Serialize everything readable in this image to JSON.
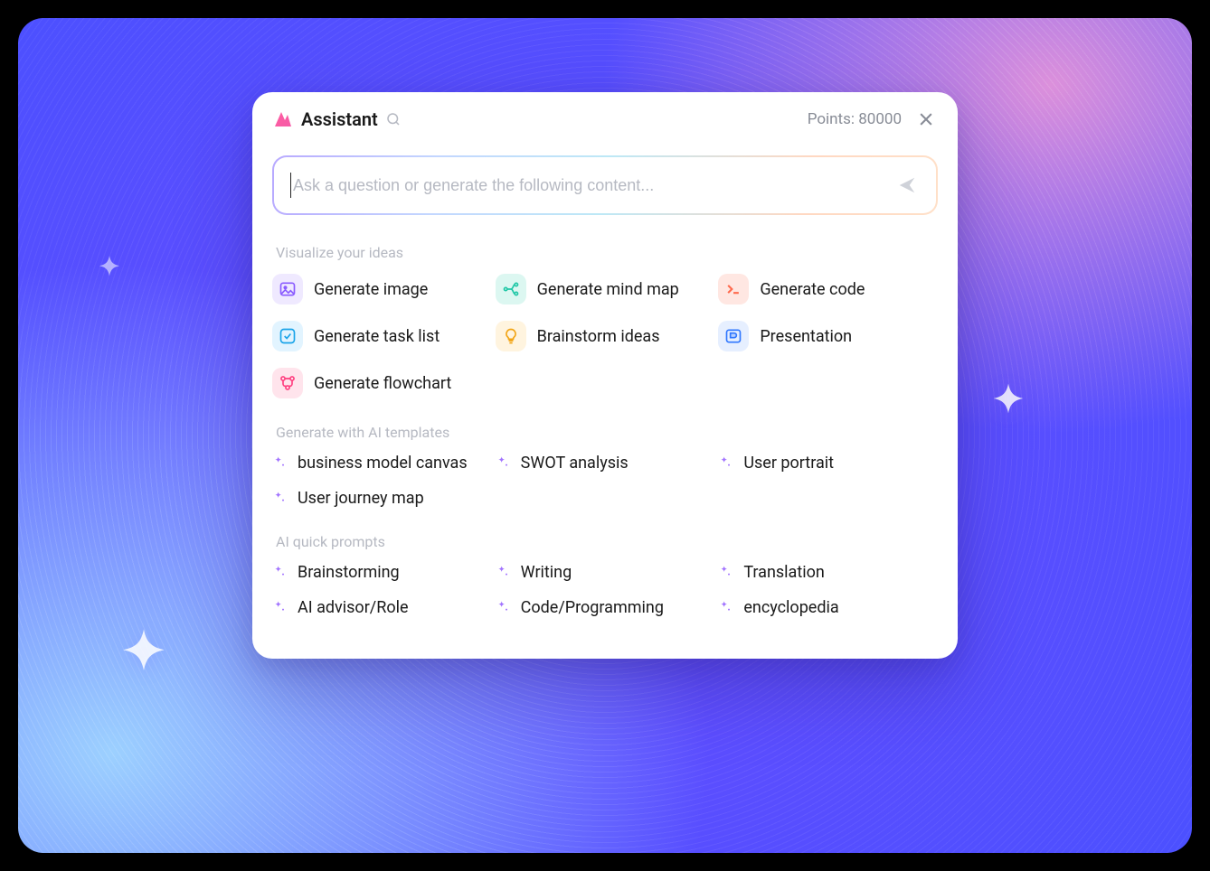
{
  "header": {
    "title": "Assistant",
    "points_label": "Points: 80000"
  },
  "input": {
    "placeholder": "Ask a question or generate the following content..."
  },
  "sections": {
    "visualize_title": "Visualize your ideas",
    "templates_title": "Generate with AI templates",
    "prompts_title": "AI quick prompts"
  },
  "visualize": [
    {
      "id": "generate-image",
      "label": "Generate image",
      "icon": "image",
      "tint": "purple"
    },
    {
      "id": "generate-mind-map",
      "label": "Generate mind map",
      "icon": "mindmap",
      "tint": "teal"
    },
    {
      "id": "generate-code",
      "label": "Generate code",
      "icon": "terminal",
      "tint": "red"
    },
    {
      "id": "generate-task-list",
      "label": "Generate task list",
      "icon": "checkbox",
      "tint": "cyan"
    },
    {
      "id": "brainstorm-ideas",
      "label": "Brainstorm ideas",
      "icon": "bulb",
      "tint": "amber"
    },
    {
      "id": "presentation",
      "label": "Presentation",
      "icon": "presentation",
      "tint": "blue"
    },
    {
      "id": "generate-flowchart",
      "label": "Generate flowchart",
      "icon": "flowchart",
      "tint": "pink"
    }
  ],
  "templates": [
    {
      "id": "business-model-canvas",
      "label": "business model canvas"
    },
    {
      "id": "swot-analysis",
      "label": "SWOT analysis"
    },
    {
      "id": "user-portrait",
      "label": "User portrait"
    },
    {
      "id": "user-journey-map",
      "label": "User journey map"
    }
  ],
  "prompts": [
    {
      "id": "brainstorming",
      "label": "Brainstorming"
    },
    {
      "id": "writing",
      "label": "Writing"
    },
    {
      "id": "translation",
      "label": "Translation"
    },
    {
      "id": "ai-advisor-role",
      "label": "AI advisor/Role"
    },
    {
      "id": "code-programming",
      "label": "Code/Programming"
    },
    {
      "id": "encyclopedia",
      "label": "encyclopedia"
    }
  ]
}
